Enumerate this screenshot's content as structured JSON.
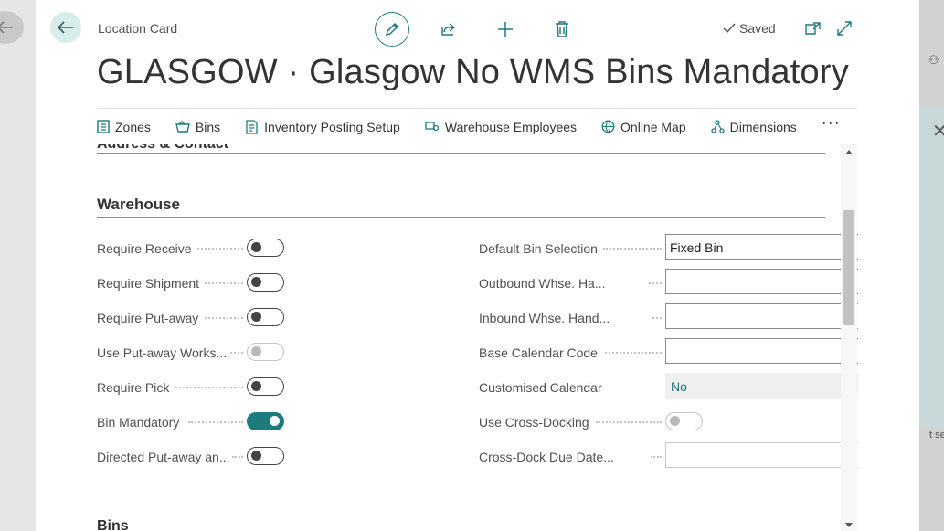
{
  "breadcrumb": "Location Card",
  "title": "GLASGOW · Glasgow No WMS Bins Mandatory",
  "status": "Saved",
  "accent_color": "#1e7b7b",
  "toolbar": {
    "edit": "pencil-icon",
    "share": "share-icon",
    "new": "plus-icon",
    "delete": "trash-icon"
  },
  "actions": [
    {
      "label": "Zones",
      "icon": "zones-icon"
    },
    {
      "label": "Bins",
      "icon": "bins-icon"
    },
    {
      "label": "Inventory Posting Setup",
      "icon": "setup-icon"
    },
    {
      "label": "Warehouse Employees",
      "icon": "employees-icon"
    },
    {
      "label": "Online Map",
      "icon": "globe-icon"
    },
    {
      "label": "Dimensions",
      "icon": "dimensions-icon"
    }
  ],
  "more": "···",
  "sections": {
    "previous": "Address & Contact",
    "current": "Warehouse",
    "next": "Bins"
  },
  "left_fields": [
    {
      "label": "Require Receive",
      "value": false
    },
    {
      "label": "Require Shipment",
      "value": false
    },
    {
      "label": "Require Put-away",
      "value": false
    },
    {
      "label": "Use Put-away Works...",
      "value": false
    },
    {
      "label": "Require Pick",
      "value": false
    },
    {
      "label": "Bin Mandatory",
      "value": true
    },
    {
      "label": "Directed Put-away an...",
      "value": false
    }
  ],
  "right_fields": [
    {
      "label": "Default Bin Selection",
      "value": "Fixed Bin"
    },
    {
      "label": "Outbound Whse. Ha...",
      "value": ""
    },
    {
      "label": "Inbound Whse. Hand...",
      "value": ""
    },
    {
      "label": "Base Calendar Code",
      "value": ""
    },
    {
      "label": "Customised Calendar",
      "value": "No"
    },
    {
      "label": "Use Cross-Docking",
      "value": false
    },
    {
      "label": "Cross-Dock Due Date...",
      "value": ""
    }
  ],
  "background": {
    "fragment": "t serv"
  }
}
